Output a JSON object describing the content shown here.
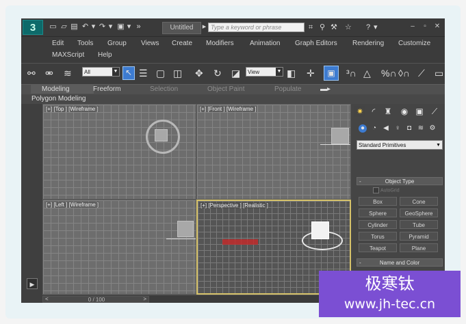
{
  "app": {
    "document_title": "Untitled",
    "search_placeholder": "Type a keyword or phrase",
    "help_label": "?"
  },
  "menu": {
    "row1": [
      "Edit",
      "Tools",
      "Group",
      "Views",
      "Create",
      "Modifiers",
      "Animation",
      "Graph Editors",
      "Rendering",
      "Customize"
    ],
    "row2": [
      "MAXScript",
      "Help"
    ]
  },
  "toolbar": {
    "selection_filter": "All",
    "reference_coord": "View"
  },
  "ribbon": {
    "tabs": [
      "Modeling",
      "Freeform",
      "Selection",
      "Object Paint",
      "Populate"
    ],
    "active_tab": "Modeling",
    "panel_label": "Polygon Modeling"
  },
  "viewports": {
    "top": "[+] [Top ] [Wireframe ]",
    "front": "[+] [Front ] [Wireframe ]",
    "left": "[+] [Left ] [Wireframe ]",
    "perspective": "[+] [Perspective ] [Realistic ]"
  },
  "command_panel": {
    "category": "Standard Primitives",
    "object_type_title": "Object Type",
    "autogrid_label": "AutoGrid",
    "buttons": [
      "Box",
      "Cone",
      "Sphere",
      "GeoSphere",
      "Cylinder",
      "Tube",
      "Torus",
      "Pyramid",
      "Teapot",
      "Plane"
    ],
    "name_color_title": "Name and Color",
    "object_color": "#c2185b"
  },
  "timeline": {
    "frame_range": "0 / 100"
  },
  "watermark": {
    "line1": "极寒钛",
    "line2": "www.jh-tec.cn"
  }
}
